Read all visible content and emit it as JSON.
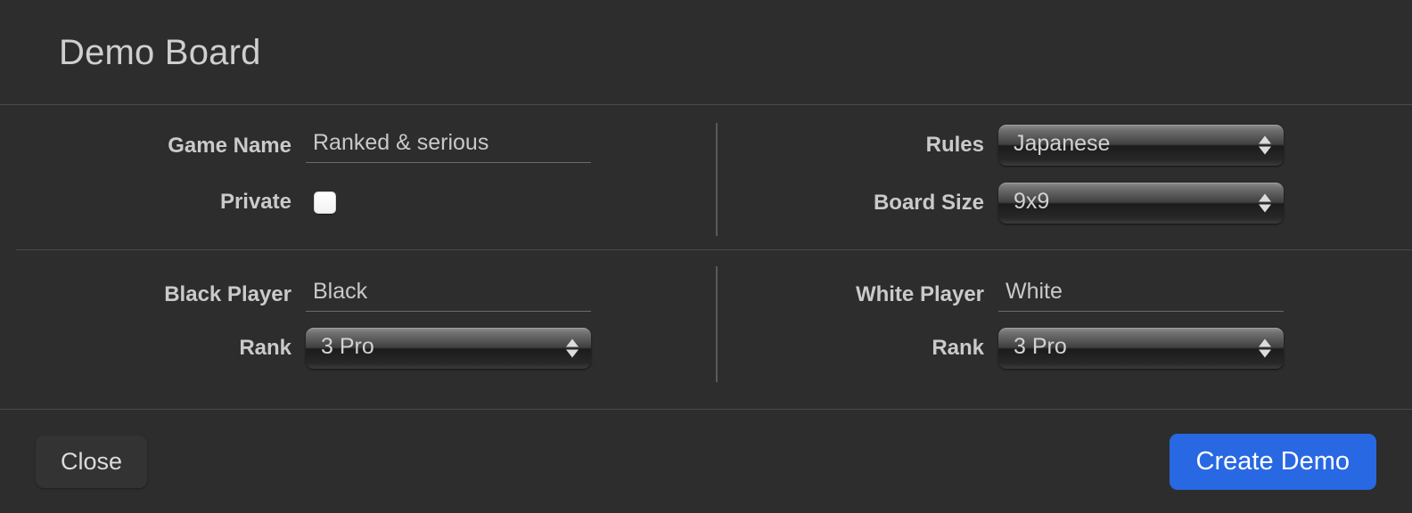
{
  "dialog": {
    "title": "Demo Board"
  },
  "game_settings": {
    "game_name": {
      "label": "Game Name",
      "value": "Ranked & serious",
      "placeholder": "Game Name"
    },
    "private": {
      "label": "Private",
      "checked": false
    },
    "rules": {
      "label": "Rules",
      "value": "Japanese"
    },
    "board_size": {
      "label": "Board Size",
      "value": "9x9"
    }
  },
  "players": {
    "black": {
      "name_label": "Black Player",
      "name_value": "Black",
      "name_placeholder": "Black",
      "rank_label": "Rank",
      "rank_value": "3 Pro"
    },
    "white": {
      "name_label": "White Player",
      "name_value": "White",
      "name_placeholder": "White",
      "rank_label": "Rank",
      "rank_value": "3 Pro"
    }
  },
  "footer": {
    "close_label": "Close",
    "create_label": "Create Demo"
  },
  "colors": {
    "background": "#2d2d2d",
    "accent": "#2868e2",
    "divider": "#4a4a4a",
    "text": "#cacaca"
  }
}
